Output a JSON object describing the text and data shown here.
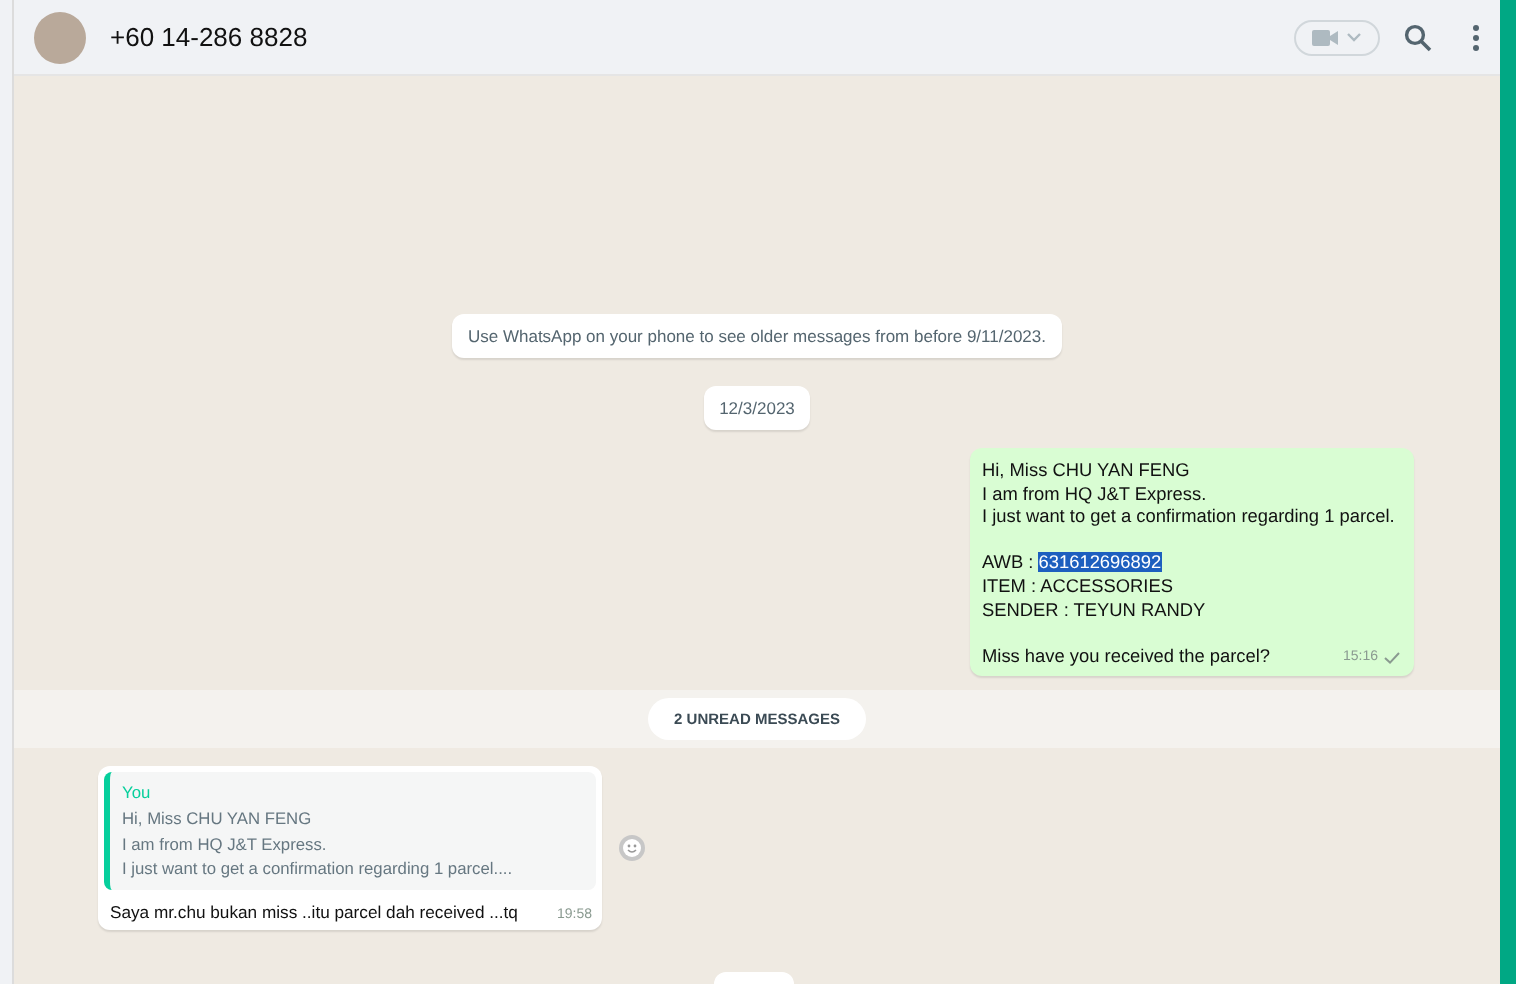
{
  "header": {
    "contact": "+60 14-286 8828"
  },
  "notice": "Use WhatsApp on your phone to see older messages from before 9/11/2023.",
  "date_divider": "12/3/2023",
  "outgoing": {
    "paragraphs": [
      [
        "Hi, Miss CHU YAN FENG",
        "I am from HQ J&T Express.",
        "I just want to get a confirmation regarding 1 parcel."
      ],
      [
        "ITEM : ACCESSORIES",
        "SENDER : TEYUN RANDY"
      ],
      [
        "Miss have you received the parcel?"
      ]
    ],
    "awb": {
      "label": "AWB :",
      "value": "631612696892",
      "selected": true
    },
    "time": "15:16"
  },
  "unread_divider": "2 UNREAD MESSAGES",
  "incoming": {
    "quote": {
      "author": "You",
      "lines": [
        "Hi, Miss CHU YAN FENG",
        "I am from HQ J&T Express.",
        "I just want to get a confirmation regarding 1 parcel...."
      ]
    },
    "text": "Saya mr.chu bukan miss ..itu parcel dah received ...tq",
    "time": "19:58"
  }
}
